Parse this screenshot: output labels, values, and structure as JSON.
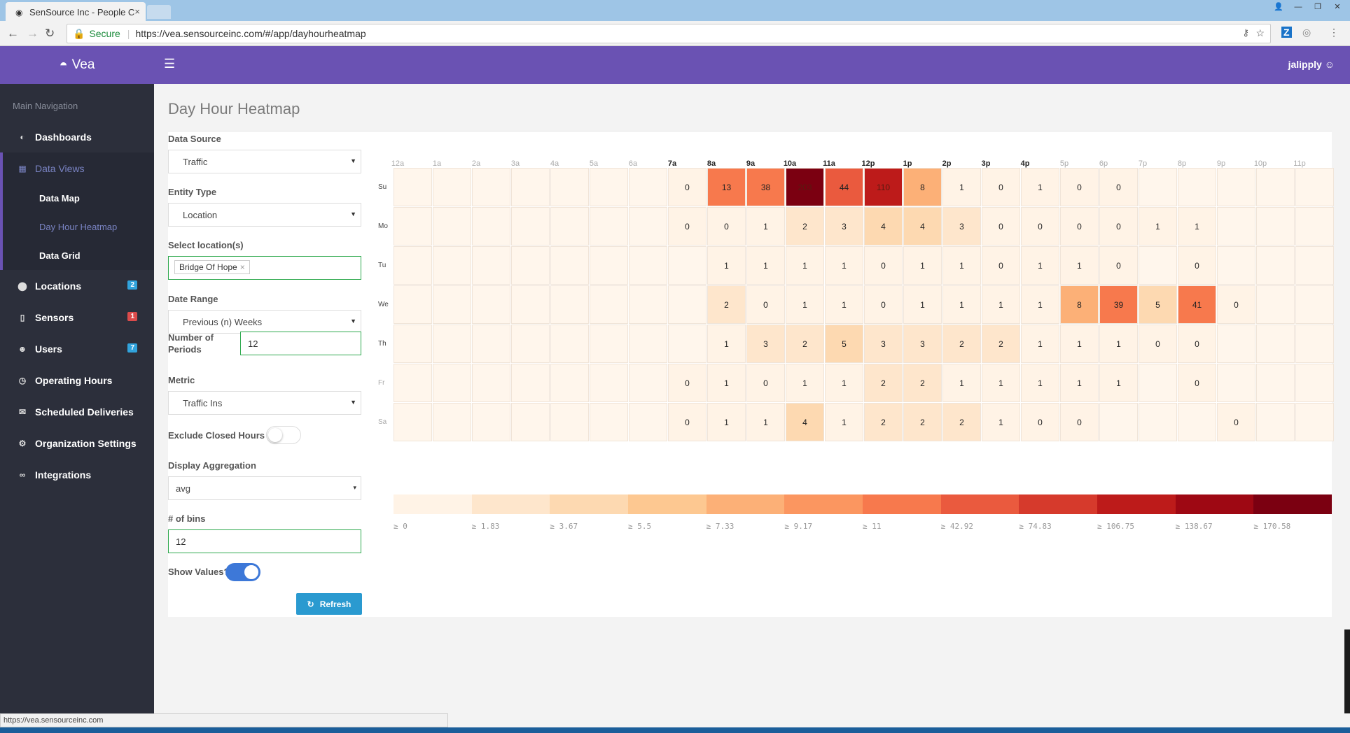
{
  "browser": {
    "tab_title": "SenSource Inc - People C",
    "secure_label": "Secure",
    "url": "https://vea.sensourceinc.com/#/app/dayhourheatmap",
    "status_url": "https://vea.sensourceinc.com"
  },
  "header": {
    "brand": "Vea",
    "user": "jalipply"
  },
  "sidebar": {
    "heading": "Main Navigation",
    "items": [
      {
        "label": "Dashboards",
        "icon": "dashboard-icon"
      },
      {
        "label": "Data Views",
        "icon": "table-icon"
      },
      {
        "label": "Locations",
        "icon": "map-marker-icon",
        "badge": "2"
      },
      {
        "label": "Sensors",
        "icon": "mobile-icon",
        "badge": "1"
      },
      {
        "label": "Users",
        "icon": "users-icon",
        "badge": "7"
      },
      {
        "label": "Operating Hours",
        "icon": "clock-icon"
      },
      {
        "label": "Scheduled Deliveries",
        "icon": "envelope-icon"
      },
      {
        "label": "Organization Settings",
        "icon": "cogs-icon"
      },
      {
        "label": "Integrations",
        "icon": "link-icon"
      }
    ],
    "subitems": [
      "Data Map",
      "Day Hour Heatmap",
      "Data Grid"
    ]
  },
  "page": {
    "title": "Day Hour Heatmap"
  },
  "form": {
    "data_source_label": "Data Source",
    "data_source_value": "Traffic",
    "entity_type_label": "Entity Type",
    "entity_type_value": "Location",
    "locations_label": "Select location(s)",
    "location_chip": "Bridge Of Hope",
    "date_range_label": "Date Range",
    "date_range_value": "Previous (n) Weeks",
    "periods_label_1": "Number of",
    "periods_label_2": "Periods",
    "periods_value": "12",
    "metric_label": "Metric",
    "metric_value": "Traffic Ins",
    "exclude_closed_label": "Exclude Closed Hours",
    "exclude_closed_on": false,
    "aggregation_label": "Display Aggregation",
    "aggregation_value": "avg",
    "bins_label": "# of bins",
    "bins_value": "12",
    "show_values_label": "Show Values?",
    "show_values_on": true,
    "refresh_label": "Refresh"
  },
  "chart_data": {
    "type": "heatmap",
    "x": [
      "12a",
      "1a",
      "2a",
      "3a",
      "4a",
      "5a",
      "6a",
      "7a",
      "8a",
      "9a",
      "10a",
      "11a",
      "12p",
      "1p",
      "2p",
      "3p",
      "4p",
      "5p",
      "6p",
      "7p",
      "8p",
      "9p",
      "10p",
      "11p"
    ],
    "y": [
      "Su",
      "Mo",
      "Tu",
      "We",
      "Th",
      "Fr",
      "Sa"
    ],
    "bold_hours": [
      7,
      8,
      9,
      10,
      11,
      12,
      13,
      14,
      15,
      16
    ],
    "faded_days": [
      5,
      6
    ],
    "values": [
      [
        null,
        null,
        null,
        null,
        null,
        null,
        null,
        0,
        13,
        38,
        203,
        44,
        110,
        8,
        1,
        0,
        1,
        0,
        0,
        null,
        null,
        null,
        null,
        null
      ],
      [
        null,
        null,
        null,
        null,
        null,
        null,
        null,
        0,
        0,
        1,
        2,
        3,
        4,
        4,
        3,
        0,
        0,
        0,
        0,
        1,
        1,
        null,
        null,
        null
      ],
      [
        null,
        null,
        null,
        null,
        null,
        null,
        null,
        null,
        1,
        1,
        1,
        1,
        0,
        1,
        1,
        0,
        1,
        1,
        0,
        null,
        0,
        null,
        null,
        null
      ],
      [
        null,
        null,
        null,
        null,
        null,
        null,
        null,
        null,
        2,
        0,
        1,
        1,
        0,
        1,
        1,
        1,
        1,
        8,
        39,
        5,
        41,
        0,
        null,
        null
      ],
      [
        null,
        null,
        null,
        null,
        null,
        null,
        null,
        null,
        1,
        3,
        2,
        5,
        3,
        3,
        2,
        2,
        1,
        1,
        1,
        0,
        0,
        null,
        null,
        null
      ],
      [
        null,
        null,
        null,
        null,
        null,
        null,
        null,
        0,
        1,
        0,
        1,
        1,
        2,
        2,
        1,
        1,
        1,
        1,
        1,
        null,
        0,
        null,
        null,
        null
      ],
      [
        null,
        null,
        null,
        null,
        null,
        null,
        null,
        0,
        1,
        1,
        4,
        1,
        2,
        2,
        2,
        1,
        0,
        0,
        null,
        null,
        null,
        0,
        null,
        null
      ]
    ],
    "bins": [
      0,
      1.83,
      3.67,
      5.5,
      7.33,
      9.17,
      11,
      42.92,
      74.83,
      106.75,
      138.67,
      170.58
    ],
    "bin_labels": [
      "≥ 0",
      "≥ 1.83",
      "≥ 3.67",
      "≥ 5.5",
      "≥ 7.33",
      "≥ 9.17",
      "≥ 11",
      "≥ 42.92",
      "≥ 74.83",
      "≥ 106.75",
      "≥ 138.67",
      "≥ 170.58"
    ],
    "colors": [
      "#fff3e6",
      "#fee6cc",
      "#fdd9b1",
      "#fdc891",
      "#fcb077",
      "#fb9660",
      "#f7794d",
      "#ea5a3e",
      "#d63a2c",
      "#bd1b1a",
      "#9e0813",
      "#7b0011"
    ],
    "show_values": true
  }
}
